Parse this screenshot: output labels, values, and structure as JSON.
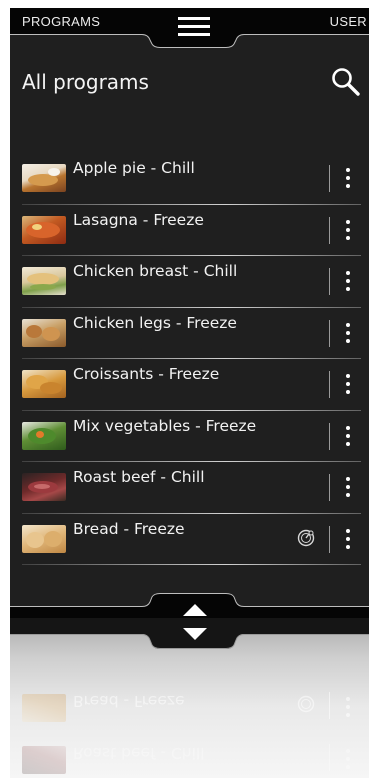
{
  "topbar": {
    "programs_tab": "PROGRAMS",
    "user_tab": "USER",
    "menu_icon": "hamburger-icon"
  },
  "header": {
    "title": "All programs",
    "search_icon": "magnifier-icon"
  },
  "programs": [
    {
      "label": "Apple pie - Chill",
      "thumb": "apple-pie"
    },
    {
      "label": "Lasagna - Freeze",
      "thumb": "lasagna"
    },
    {
      "label": "Chicken breast - Chill",
      "thumb": "chicken-breast"
    },
    {
      "label": "Chicken legs - Freeze",
      "thumb": "chicken-legs"
    },
    {
      "label": "Croissants - Freeze",
      "thumb": "croissants"
    },
    {
      "label": "Mix vegetables - Freeze",
      "thumb": "mix-vegetables"
    },
    {
      "label": "Roast beef - Chill",
      "thumb": "roast-beef"
    },
    {
      "label": "Bread - Freeze",
      "thumb": "bread",
      "status_icon": "timer-icon"
    }
  ],
  "icons": {
    "more": "more-vertical-icon",
    "scroll_up": "arrow-up-icon",
    "scroll_down": "arrow-down-icon"
  },
  "colors": {
    "panel_bg": "#1f1f1f",
    "text": "#f2f2f2",
    "accent": "#ffffff"
  }
}
